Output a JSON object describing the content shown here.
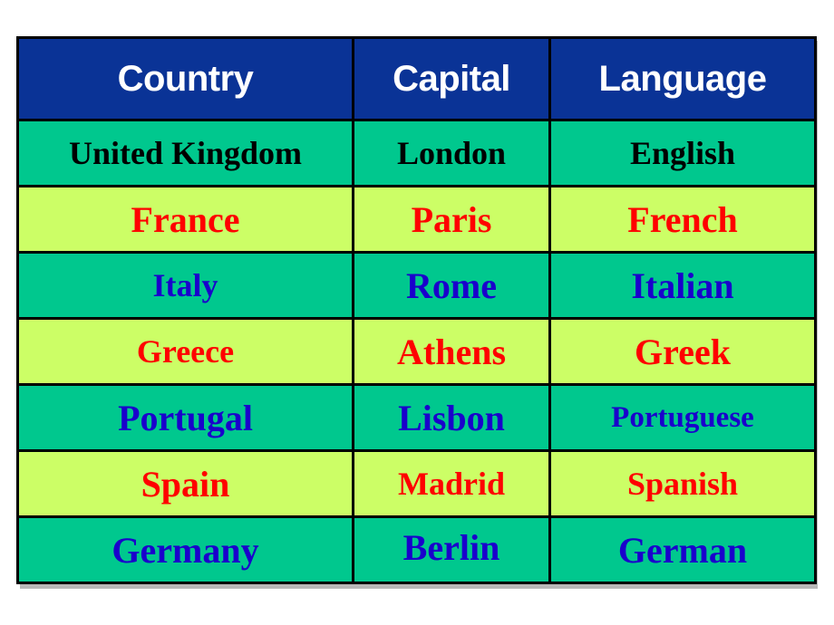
{
  "table": {
    "columns": [
      {
        "key": "country",
        "label": "Country"
      },
      {
        "key": "capital",
        "label": "Capital"
      },
      {
        "key": "language",
        "label": "Language"
      }
    ],
    "header": {
      "background": "#0a3396",
      "text_color": "#ffffff"
    },
    "row_backgrounds": {
      "teal": "#00c88e",
      "lime": "#ccfe66"
    },
    "text_colors": {
      "black": "#000000",
      "red": "#ff0000",
      "blue": "#1a00cc"
    },
    "border_color": "#000000",
    "rows": [
      {
        "country": "United Kingdom",
        "capital": "London",
        "language": "English",
        "background": "teal",
        "ink": "black"
      },
      {
        "country": "France",
        "capital": "Paris",
        "language": "French",
        "background": "lime",
        "ink": "red"
      },
      {
        "country": "Italy",
        "capital": "Rome",
        "language": "Italian",
        "background": "teal",
        "ink": "blue"
      },
      {
        "country": "Greece",
        "capital": "Athens",
        "language": "Greek",
        "background": "lime",
        "ink": "red"
      },
      {
        "country": "Portugal",
        "capital": "Lisbon",
        "language": "Portuguese",
        "background": "teal",
        "ink": "blue"
      },
      {
        "country": "Spain",
        "capital": "Madrid",
        "language": "Spanish",
        "background": "lime",
        "ink": "red"
      },
      {
        "country": "Germany",
        "capital": "Berlin",
        "language": "German",
        "background": "teal",
        "ink": "blue"
      }
    ]
  }
}
